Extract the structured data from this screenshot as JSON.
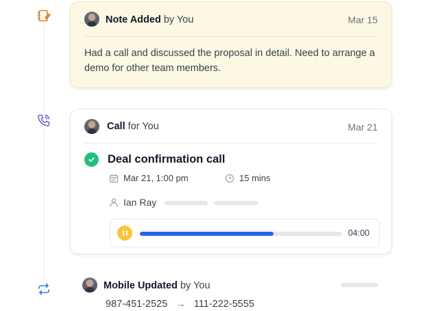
{
  "colors": {
    "note_icon": "#e07a1f",
    "call_icon": "#6d5bd0",
    "update_icon": "#2b83d9",
    "success": "#22c080",
    "progress": "#2563eb",
    "pause": "#f9c63a"
  },
  "note": {
    "icon": "note-edit-icon",
    "title": "Note Added",
    "by": "by You",
    "date": "Mar 15",
    "body": "Had a call and discussed the proposal in detail. Need to arrange a demo for other team members."
  },
  "call": {
    "icon": "phone-call-icon",
    "title": "Call",
    "by": "for You",
    "date": "Mar 21",
    "subject": "Deal confirmation call",
    "datetime": "Mar 21, 1:00 pm",
    "duration_text": "15 mins",
    "participant": "Ian Ray",
    "player": {
      "progress_fraction": 0.66,
      "time": "04:00"
    }
  },
  "update": {
    "icon": "sync-arrows-icon",
    "title": "Mobile Updated",
    "by": "by You",
    "old_value": "987-451-2525",
    "arrow": "→",
    "new_value": "111-222-5555"
  }
}
